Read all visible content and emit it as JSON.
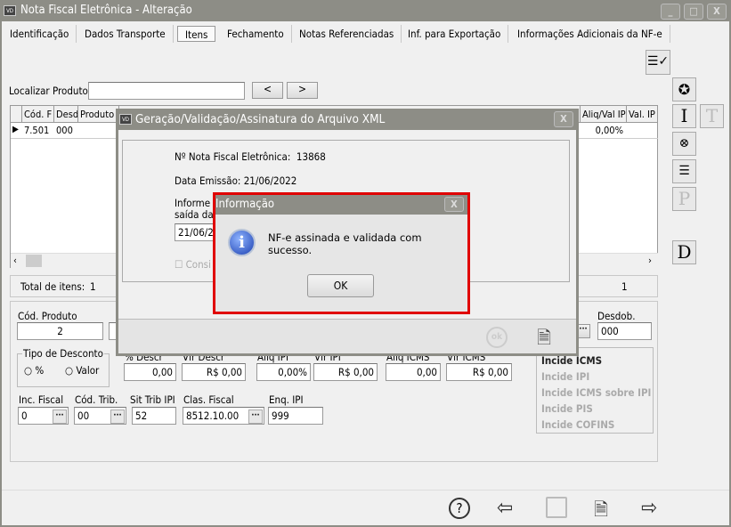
{
  "window": {
    "title": "Nota Fiscal Eletrônica - Alteração",
    "icon_text": "VD"
  },
  "tabs": [
    "Identificação",
    "Dados Transporte",
    "Itens",
    "Fechamento",
    "Notas Referenciadas",
    "Inf. para Exportação",
    "Informações Adicionais da NF-e"
  ],
  "active_tab": "Itens",
  "search": {
    "label": "Localizar Produto",
    "value": "",
    "prev": "<",
    "next": ">"
  },
  "grid": {
    "headers": [
      "Cód. F",
      "Desd",
      "Produto",
      "Aliq/Val IP",
      "Val. IP"
    ],
    "rows": [
      {
        "cod": "7.501",
        "desd": "000",
        "aliq": "0,00%"
      }
    ]
  },
  "totals": {
    "label": "Total de itens:",
    "value": "1",
    "right_value": "1"
  },
  "form": {
    "cod_produto": {
      "label": "Cód. Produto",
      "value": "2"
    },
    "desdob": {
      "label": "Desdob.",
      "value": "000"
    },
    "tipo_desconto": {
      "label": "Tipo de Desconto",
      "options": [
        "%",
        "Valor"
      ]
    },
    "row2": [
      {
        "label": "% Descr",
        "value": "0,00"
      },
      {
        "label": "Vlr Descr",
        "value": "R$ 0,00"
      },
      {
        "label": "Aliq IPI",
        "value": "0,00%"
      },
      {
        "label": "Vlr IPI",
        "value": "R$ 0,00"
      },
      {
        "label": "Aliq ICMS",
        "value": "0,00"
      },
      {
        "label": "Vlr ICMS",
        "value": "R$ 0,00"
      }
    ],
    "inc_fiscal": {
      "label": "Inc. Fiscal",
      "value": "0"
    },
    "cod_trib": {
      "label": "Cód. Trib.",
      "value": "00"
    },
    "sit_trib_ipi": {
      "label": "Sit Trib IPI",
      "value": "52"
    },
    "clas_fiscal": {
      "label": "Clas. Fiscal",
      "value": "8512.10.00"
    },
    "enq_ipi": {
      "label": "Enq. IPI",
      "value": "999"
    },
    "incide": [
      "Incide ICMS",
      "Incide IPI",
      "Incide ICMS sobre IPI",
      "Incide PIS",
      "Incide COFINS"
    ]
  },
  "xml_dialog": {
    "title": "Geração/Validação/Assinatura do Arquivo XML",
    "nf_label": "Nº Nota Fiscal Eletrônica:",
    "nf_value": "13868",
    "date_label": "Data Emissão: 21/06/2022",
    "inform_line1": "Informe a",
    "inform_line2": "saída da",
    "date_value": "21/06/20",
    "checkbox_label": "Consi",
    "ok_label": "ok"
  },
  "info_dialog": {
    "title": "Informação",
    "message": "NF-e assinada e validada com sucesso.",
    "ok": "OK",
    "border_color": "#e00000"
  },
  "side_buttons": [
    "I",
    "T",
    "P",
    "D"
  ]
}
